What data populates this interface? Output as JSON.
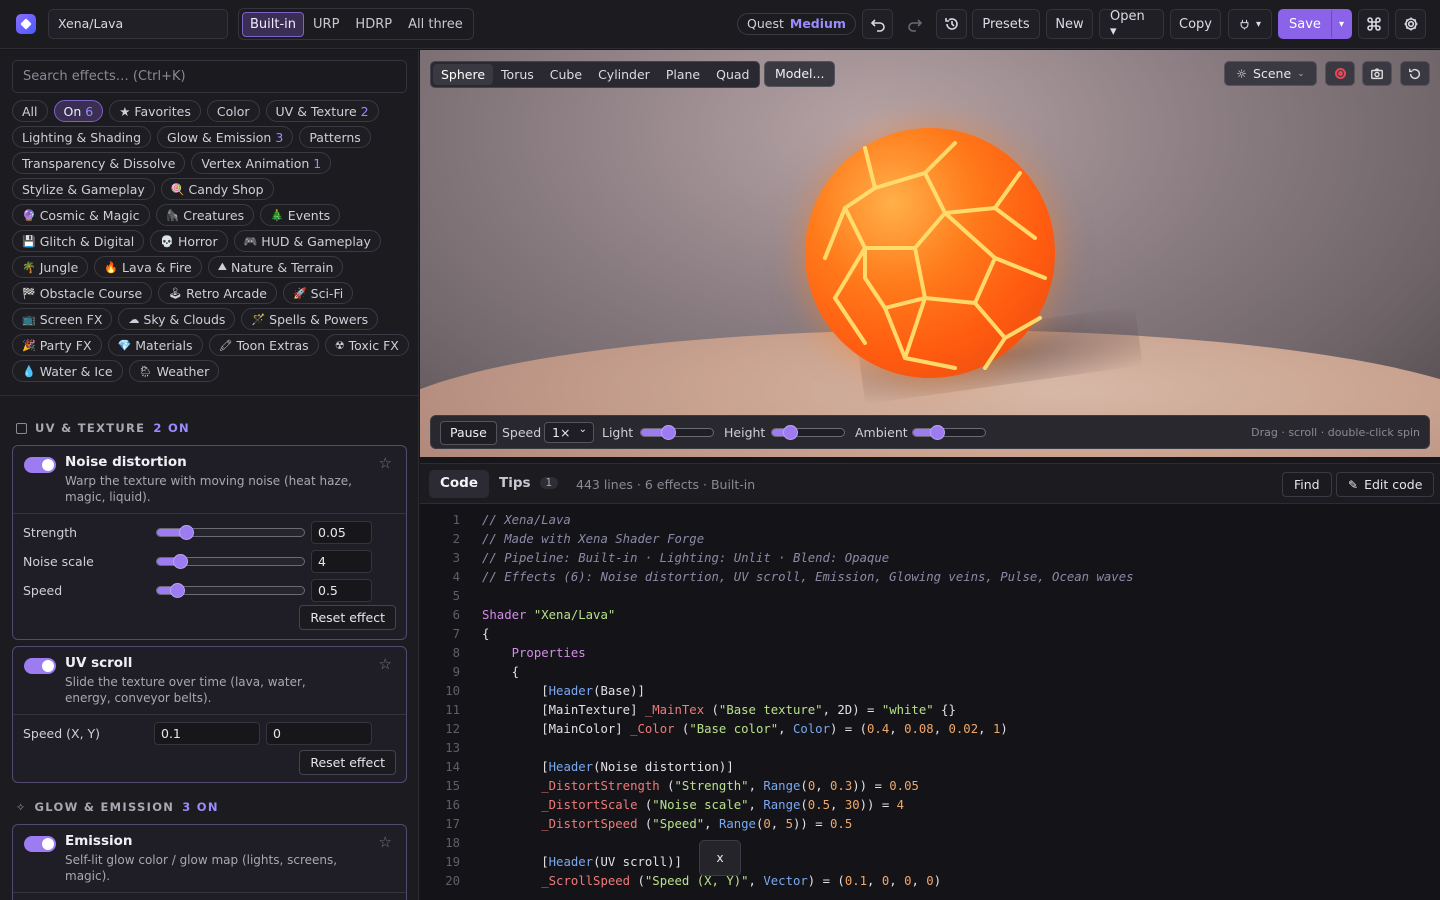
{
  "header": {
    "shader_name": "Xena/Lava",
    "pipelines": [
      "Built-in",
      "URP",
      "HDRP",
      "All three"
    ],
    "active_pipeline": "Built-in",
    "quest_label": "Quest",
    "quest_value": "Medium",
    "presets": "Presets",
    "new": "New",
    "open": "Open ▾",
    "copy": "Copy",
    "plugin": "▾",
    "save": "Save",
    "save_split": "▾"
  },
  "sidebar": {
    "search_placeholder": "Search effects… (Ctrl+K)",
    "chips": [
      {
        "label": "All",
        "count": "",
        "emoji": "",
        "on": false
      },
      {
        "label": "On",
        "count": "6",
        "emoji": "",
        "on": true
      },
      {
        "label": "★ Favorites",
        "count": "",
        "emoji": "",
        "on": false
      },
      {
        "label": "Color",
        "count": "",
        "emoji": "",
        "on": false
      },
      {
        "label": "UV & Texture",
        "count": "2",
        "emoji": "",
        "on": false
      },
      {
        "label": "Lighting & Shading",
        "count": "",
        "emoji": "",
        "on": false
      },
      {
        "label": "Glow & Emission",
        "count": "3",
        "emoji": "",
        "on": false
      },
      {
        "label": "Patterns",
        "count": "",
        "emoji": "",
        "on": false
      },
      {
        "label": "Transparency & Dissolve",
        "count": "",
        "emoji": "",
        "on": false
      },
      {
        "label": "Vertex Animation",
        "count": "1",
        "emoji": "",
        "on": false
      },
      {
        "label": "Stylize & Gameplay",
        "count": "",
        "emoji": "",
        "on": false
      },
      {
        "label": "Candy Shop",
        "count": "",
        "emoji": "🍭",
        "on": false
      },
      {
        "label": "Cosmic & Magic",
        "count": "",
        "emoji": "🔮",
        "on": false
      },
      {
        "label": "Creatures",
        "count": "",
        "emoji": "🦍",
        "on": false
      },
      {
        "label": "Events",
        "count": "",
        "emoji": "🎄",
        "on": false
      },
      {
        "label": "Glitch & Digital",
        "count": "",
        "emoji": "💾",
        "on": false
      },
      {
        "label": "Horror",
        "count": "",
        "emoji": "💀",
        "on": false
      },
      {
        "label": "HUD & Gameplay",
        "count": "",
        "emoji": "🎮",
        "on": false
      },
      {
        "label": "Jungle",
        "count": "",
        "emoji": "🌴",
        "on": false
      },
      {
        "label": "Lava & Fire",
        "count": "",
        "emoji": "🔥",
        "on": false
      },
      {
        "label": "Nature & Terrain",
        "count": "",
        "emoji": "⛰",
        "on": false
      },
      {
        "label": "Obstacle Course",
        "count": "",
        "emoji": "🏁",
        "on": false
      },
      {
        "label": "Retro Arcade",
        "count": "",
        "emoji": "🕹",
        "on": false
      },
      {
        "label": "Sci-Fi",
        "count": "",
        "emoji": "🚀",
        "on": false
      },
      {
        "label": "Screen FX",
        "count": "",
        "emoji": "📺",
        "on": false
      },
      {
        "label": "Sky & Clouds",
        "count": "",
        "emoji": "☁",
        "on": false
      },
      {
        "label": "Spells & Powers",
        "count": "",
        "emoji": "🪄",
        "on": false
      },
      {
        "label": "Party FX",
        "count": "",
        "emoji": "🎉",
        "on": false
      },
      {
        "label": "Materials",
        "count": "",
        "emoji": "💎",
        "on": false
      },
      {
        "label": "Toon Extras",
        "count": "",
        "emoji": "🖍",
        "on": false
      },
      {
        "label": "Toxic FX",
        "count": "",
        "emoji": "☢",
        "on": false
      },
      {
        "label": "Water & Ice",
        "count": "",
        "emoji": "💧",
        "on": false
      },
      {
        "label": "Weather",
        "count": "",
        "emoji": "🌦",
        "on": false
      }
    ],
    "section_uv": {
      "title": "UV & TEXTURE",
      "count": "2 ON"
    },
    "section_glow": {
      "title": "GLOW & EMISSION",
      "count": "3 ON"
    },
    "noise": {
      "title": "Noise distortion",
      "desc": "Warp the texture with moving noise (heat haze, magic, liquid).",
      "params": [
        {
          "label": "Strength",
          "value": "0.05",
          "level": 0.17
        },
        {
          "label": "Noise scale",
          "value": "4",
          "level": 0.12
        },
        {
          "label": "Speed",
          "value": "0.5",
          "level": 0.1
        }
      ],
      "reset": "Reset effect"
    },
    "uvscroll": {
      "title": "UV scroll",
      "desc": "Slide the texture over time (lava, water, energy, conveyor belts).",
      "param_label": "Speed (X, Y)",
      "x": "0.1",
      "y": "0",
      "reset": "Reset effect"
    },
    "emission": {
      "title": "Emission",
      "desc": "Self-lit glow color / glow map (lights, screens, magic)."
    }
  },
  "viewport": {
    "shapes": [
      "Sphere",
      "Torus",
      "Cube",
      "Cylinder",
      "Plane",
      "Quad"
    ],
    "active_shape": "Sphere",
    "model": "Model...",
    "scene": "Scene",
    "pause": "Pause",
    "speed_label": "Speed",
    "speed_value": "1×",
    "light_label": "Light",
    "light_level": 0.35,
    "height_label": "Height",
    "height_level": 0.2,
    "ambient_label": "Ambient",
    "ambient_level": 0.3,
    "hint": "Drag · scroll · double-click spin"
  },
  "code": {
    "tab_code": "Code",
    "tab_tips": "Tips",
    "tips_count": "1",
    "meta": "443 lines · 6 effects · Built-in",
    "find": "Find",
    "edit": "Edit code",
    "close": "x",
    "lines": [
      {
        "n": "1",
        "html": "<span class='c-com'>// Xena/Lava</span>"
      },
      {
        "n": "2",
        "html": "<span class='c-com'>// Made with Xena Shader Forge</span>"
      },
      {
        "n": "3",
        "html": "<span class='c-com'>// Pipeline: Built-in · Lighting: Unlit · Blend: Opaque</span>"
      },
      {
        "n": "4",
        "html": "<span class='c-com'>// Effects (6): Noise distortion, UV scroll, Emission, Glowing veins, Pulse, Ocean waves</span>"
      },
      {
        "n": "5",
        "html": ""
      },
      {
        "n": "6",
        "html": "<span class='c-kw'>Shader</span> <span class='c-str'>\"Xena/Lava\"</span>"
      },
      {
        "n": "7",
        "html": "{"
      },
      {
        "n": "8",
        "html": "    <span class='c-kw'>Properties</span>"
      },
      {
        "n": "9",
        "html": "    {"
      },
      {
        "n": "10",
        "html": "        [<span class='c-typ'>Header</span>(Base)]"
      },
      {
        "n": "11",
        "html": "        [MainTexture] <span class='c-var'>_MainTex</span> (<span class='c-str'>\"Base texture\"</span>, 2D) = <span class='c-str'>\"white\"</span> {}"
      },
      {
        "n": "12",
        "html": "        [MainColor] <span class='c-var'>_Color</span> (<span class='c-str'>\"Base color\"</span>, <span class='c-typ'>Color</span>) = (<span class='c-num'>0.4</span>, <span class='c-num'>0.08</span>, <span class='c-num'>0.02</span>, <span class='c-num'>1</span>)"
      },
      {
        "n": "13",
        "html": ""
      },
      {
        "n": "14",
        "html": "        [<span class='c-typ'>Header</span>(Noise distortion)]"
      },
      {
        "n": "15",
        "html": "        <span class='c-var'>_DistortStrength</span> (<span class='c-str'>\"Strength\"</span>, <span class='c-typ'>Range</span>(<span class='c-num'>0</span>, <span class='c-num'>0.3</span>)) = <span class='c-num'>0.05</span>"
      },
      {
        "n": "16",
        "html": "        <span class='c-var'>_DistortScale</span> (<span class='c-str'>\"Noise scale\"</span>, <span class='c-typ'>Range</span>(<span class='c-num'>0.5</span>, <span class='c-num'>30</span>)) = <span class='c-num'>4</span>"
      },
      {
        "n": "17",
        "html": "        <span class='c-var'>_DistortSpeed</span> (<span class='c-str'>\"Speed\"</span>, <span class='c-typ'>Range</span>(<span class='c-num'>0</span>, <span class='c-num'>5</span>)) = <span class='c-num'>0.5</span>"
      },
      {
        "n": "18",
        "html": ""
      },
      {
        "n": "19",
        "html": "        [<span class='c-typ'>Header</span>(UV scroll)]"
      },
      {
        "n": "20",
        "html": "        <span class='c-var'>_ScrollSpeed</span> (<span class='c-str'>\"Speed (X, Y)\"</span>, <span class='c-typ'>Vector</span>) = (<span class='c-num'>0.1</span>, <span class='c-num'>0</span>, <span class='c-num'>0</span>, <span class='c-num'>0</span>)"
      }
    ]
  },
  "colors": {
    "accent": "#9c7cf0",
    "save": "#8a63e8",
    "lava": "#ff7a1a"
  }
}
